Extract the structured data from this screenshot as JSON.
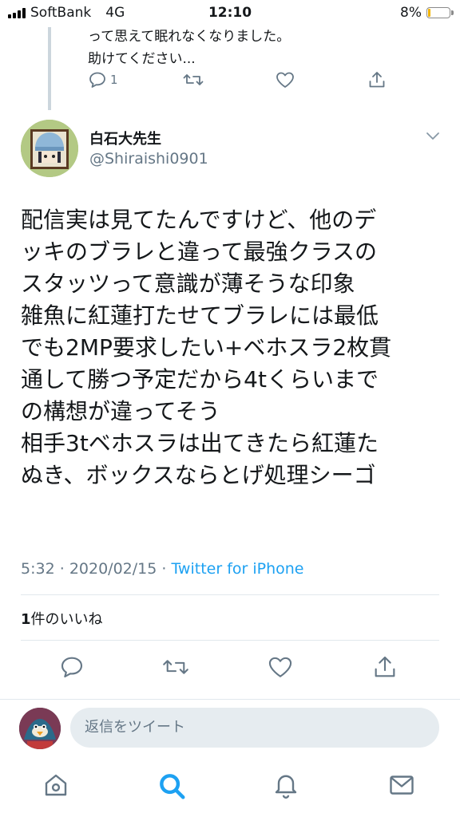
{
  "status_bar": {
    "carrier": "SoftBank",
    "network": "4G",
    "time": "12:10",
    "battery_percent": "8%",
    "battery_level": 0.08
  },
  "previous_tweet": {
    "text_lines": [
      "って思えて眠れなくなりました。",
      "助けてください..."
    ],
    "reply_count": "1"
  },
  "tweet": {
    "author_name": "白石大先生",
    "author_handle": "@Shiraishi0901",
    "body_lines": [
      "配信実は見てたんですけど、他のデ",
      "ッキのブラレと違って最強クラスの",
      "スタッツって意識が薄そうな印象",
      "雑魚に紅蓮打たせてブラレには最低",
      "でも2MP要求したい+ベホスラ2枚貫",
      "通して勝つ予定だから4tくらいまで",
      "の構想が違ってそう",
      "相手3tベホスラは出てきたら紅蓮た",
      "ぬき、ボックスならとげ処理シーゴ"
    ],
    "time": "5:32",
    "date": "2020/02/15",
    "separator": "·",
    "client": "Twitter for iPhone",
    "like_count": "1",
    "like_label": "件のいいね"
  },
  "reply": {
    "placeholder": "返信をツイート"
  },
  "icons": {
    "reply": "reply-icon",
    "retweet": "retweet-icon",
    "like": "heart-icon",
    "share": "share-icon",
    "home": "home-icon",
    "search": "search-icon",
    "notifications": "bell-icon",
    "messages": "mail-icon"
  },
  "colors": {
    "accent": "#1da1f2",
    "muted": "#657786",
    "text": "#14171a",
    "divider": "#e1e8ed"
  }
}
